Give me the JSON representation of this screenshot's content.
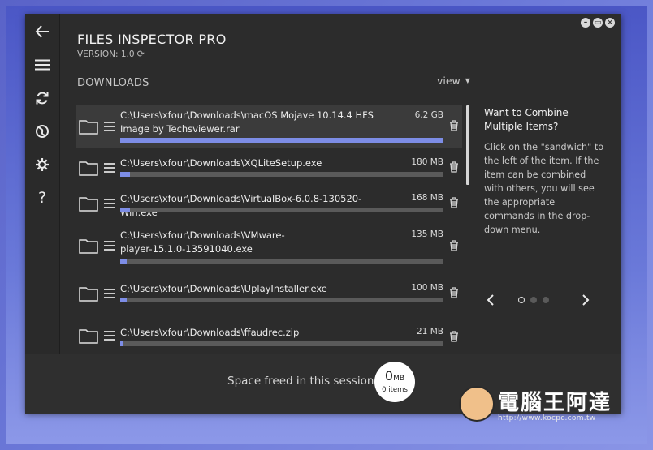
{
  "app": {
    "title": "FILES INSPECTOR PRO",
    "version": "VERSION: 1.0"
  },
  "colors": {
    "accent": "#7d8de6",
    "window_bg": "#2c2c2c",
    "selected_row": "#3b3b3b"
  },
  "rail": {
    "icons": [
      "back-arrow-icon",
      "hamburger-menu-icon",
      "refresh-icon",
      "globe-icon",
      "gear-icon",
      "help-icon"
    ],
    "help_glyph": "?"
  },
  "downloads": {
    "section_label": "DOWNLOADS",
    "view_label": "view",
    "items": [
      {
        "path": "C:\\Users\\xfour\\Downloads\\macOS Mojave 10.14.4 HFS Image by Techsviewer.rar",
        "size": "6.2 GB",
        "progress": 1.0
      },
      {
        "path": "C:\\Users\\xfour\\Downloads\\XQLiteSetup.exe",
        "size": "180 MB",
        "progress": 0.03
      },
      {
        "path": "C:\\Users\\xfour\\Downloads\\VirtualBox-6.0.8-130520-Win.exe",
        "size": "168 MB",
        "progress": 0.03
      },
      {
        "path": "C:\\Users\\xfour\\Downloads\\VMware-player-15.1.0-13591040.exe",
        "size": "135 MB",
        "progress": 0.02
      },
      {
        "path": "C:\\Users\\xfour\\Downloads\\UplayInstaller.exe",
        "size": "100 MB",
        "progress": 0.02
      },
      {
        "path": "C:\\Users\\xfour\\Downloads\\ffaudrec.zip",
        "size": "21 MB",
        "progress": 0.01
      }
    ]
  },
  "tip": {
    "heading": "Want to Combine Multiple Items?",
    "body": "Click on the \"sandwich\" to the left of the item. If the item can be combined with others, you will see the appropriate commands in the drop-down menu.",
    "page": 1,
    "pages": 3
  },
  "footer": {
    "label": "Space freed in this session:",
    "amount": "0",
    "unit": "MB",
    "items": "0 items"
  },
  "watermark": {
    "brand": "電腦王阿達",
    "url": "http://www.kocpc.com.tw"
  }
}
